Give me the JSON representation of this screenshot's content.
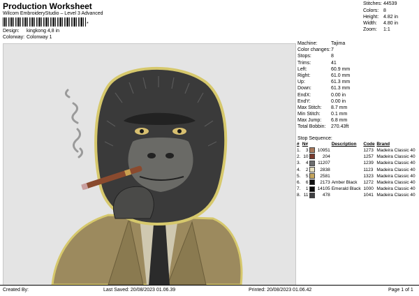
{
  "header": {
    "title": "Production Worksheet",
    "subtitle": "Wilcom EmbroideryStudio – Level 3 Advanced",
    "barcode_suffix": "*"
  },
  "design_info": [
    {
      "label": "Design:",
      "value": "kingkong 4,8 in"
    },
    {
      "label": "Colorway:",
      "value": "Colonway 1"
    }
  ],
  "summary": [
    {
      "label": "Stitches:",
      "value": "44539"
    },
    {
      "label": "Colors:",
      "value": "8"
    },
    {
      "label": "Height:",
      "value": "4.82 in"
    },
    {
      "label": "Width:",
      "value": "4.80 in"
    },
    {
      "label": "Zoom:",
      "value": "1:1"
    }
  ],
  "specs": [
    {
      "label": "Machine:",
      "value": "Tajima"
    },
    {
      "label": "Color changes:",
      "value": "7"
    },
    {
      "label": "Stops:",
      "value": "8"
    },
    {
      "label": "Trims:",
      "value": "41"
    },
    {
      "label": "Left:",
      "value": "60.9 mm"
    },
    {
      "label": "Right:",
      "value": "61.0 mm"
    },
    {
      "label": "Up:",
      "value": "61.3 mm"
    },
    {
      "label": "Down:",
      "value": "61.3 mm"
    },
    {
      "label": "EndX:",
      "value": "0.00 in"
    },
    {
      "label": "EndY:",
      "value": "0.00 in"
    },
    {
      "label": "Max Stitch:",
      "value": "8.7 mm"
    },
    {
      "label": "Min Stitch:",
      "value": "0.1 mm"
    },
    {
      "label": "Max Jump:",
      "value": "6.8 mm"
    },
    {
      "label": "Total Bobbin:",
      "value": "270.43ft"
    }
  ],
  "stop_sequence": {
    "title": "Stop Sequence:",
    "headers": [
      "#",
      "N#",
      "",
      "",
      "Description",
      "Code",
      "Brand"
    ],
    "rows": [
      {
        "idx": "1.",
        "n": "3",
        "color": "#a87a5c",
        "code_no": "10951",
        "desc": "",
        "code": "1273",
        "brand": "Madeira Classic 40"
      },
      {
        "idx": "2.",
        "n": "10",
        "color": "#7a3b2e",
        "code_no": "204",
        "desc": "",
        "code": "1257",
        "brand": "Madeira Classic 40"
      },
      {
        "idx": "3.",
        "n": "4",
        "color": "#6d6e70",
        "code_no": "11207",
        "desc": "",
        "code": "1239",
        "brand": "Madeira Classic 40"
      },
      {
        "idx": "4.",
        "n": "2",
        "color": "#e6dfbf",
        "code_no": "2838",
        "desc": "",
        "code": "1123",
        "brand": "Madeira Classic 40"
      },
      {
        "idx": "5.",
        "n": "5",
        "color": "#c4a45c",
        "code_no": "2581",
        "desc": "",
        "code": "1323",
        "brand": "Madeira Classic 40"
      },
      {
        "idx": "6.",
        "n": "6",
        "color": "#111111",
        "code_no": "2173",
        "desc": "Amber Black",
        "code": "1272",
        "brand": "Madeira Classic 40"
      },
      {
        "idx": "7.",
        "n": "1",
        "color": "#0a0a0a",
        "code_no": "14105",
        "desc": "Emerald Black",
        "code": "1000",
        "brand": "Madeira Classic 40"
      },
      {
        "idx": "8.",
        "n": "11",
        "color": "#3e3f42",
        "code_no": "478",
        "desc": "",
        "code": "1041",
        "brand": "Madeira Classic 40"
      }
    ]
  },
  "footer": {
    "created_by": "Created By:",
    "last_saved": "Last Saved: 20/08/2023 01.06.39",
    "printed": "Printed: 20/08/2023 01.06.42",
    "page": "Page 1 of 1"
  }
}
